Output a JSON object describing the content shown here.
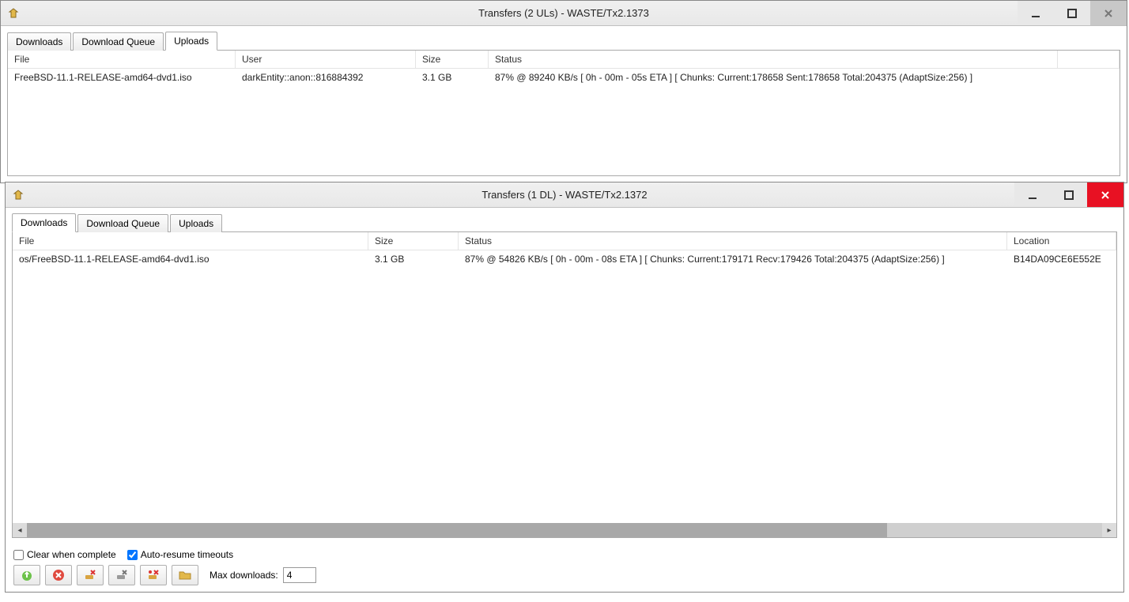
{
  "window1": {
    "title": "Transfers (2 ULs) - WASTE/Tx2.1373",
    "tabs": [
      {
        "label": "Downloads",
        "active": false
      },
      {
        "label": "Download Queue",
        "active": false
      },
      {
        "label": "Uploads",
        "active": true
      }
    ],
    "columns": {
      "file": "File",
      "user": "User",
      "size": "Size",
      "status": "Status"
    },
    "rows": [
      {
        "file": "FreeBSD-11.1-RELEASE-amd64-dvd1.iso",
        "user": "darkEntity::anon::816884392",
        "size": "3.1 GB",
        "status": "87% @ 89240 KB/s [ 0h - 00m - 05s ETA ] [ Chunks: Current:178658 Sent:178658 Total:204375 (AdaptSize:256) ]"
      }
    ]
  },
  "window2": {
    "title": "Transfers (1 DL) - WASTE/Tx2.1372",
    "tabs": [
      {
        "label": "Downloads",
        "active": true
      },
      {
        "label": "Download Queue",
        "active": false
      },
      {
        "label": "Uploads",
        "active": false
      }
    ],
    "columns": {
      "file": "File",
      "size": "Size",
      "status": "Status",
      "location": "Location"
    },
    "rows": [
      {
        "file": "os/FreeBSD-11.1-RELEASE-amd64-dvd1.iso",
        "size": "3.1 GB",
        "status": "87% @ 54826 KB/s [ 0h - 00m - 08s ETA ] [ Chunks: Current:179171 Recv:179426 Total:204375 (AdaptSize:256) ]",
        "location": "B14DA09CE6E552E"
      }
    ],
    "options": {
      "clear_when_complete": {
        "label": "Clear when complete",
        "checked": false
      },
      "auto_resume": {
        "label": "Auto-resume timeouts",
        "checked": true
      }
    },
    "max_downloads_label": "Max downloads:",
    "max_downloads_value": "4"
  }
}
